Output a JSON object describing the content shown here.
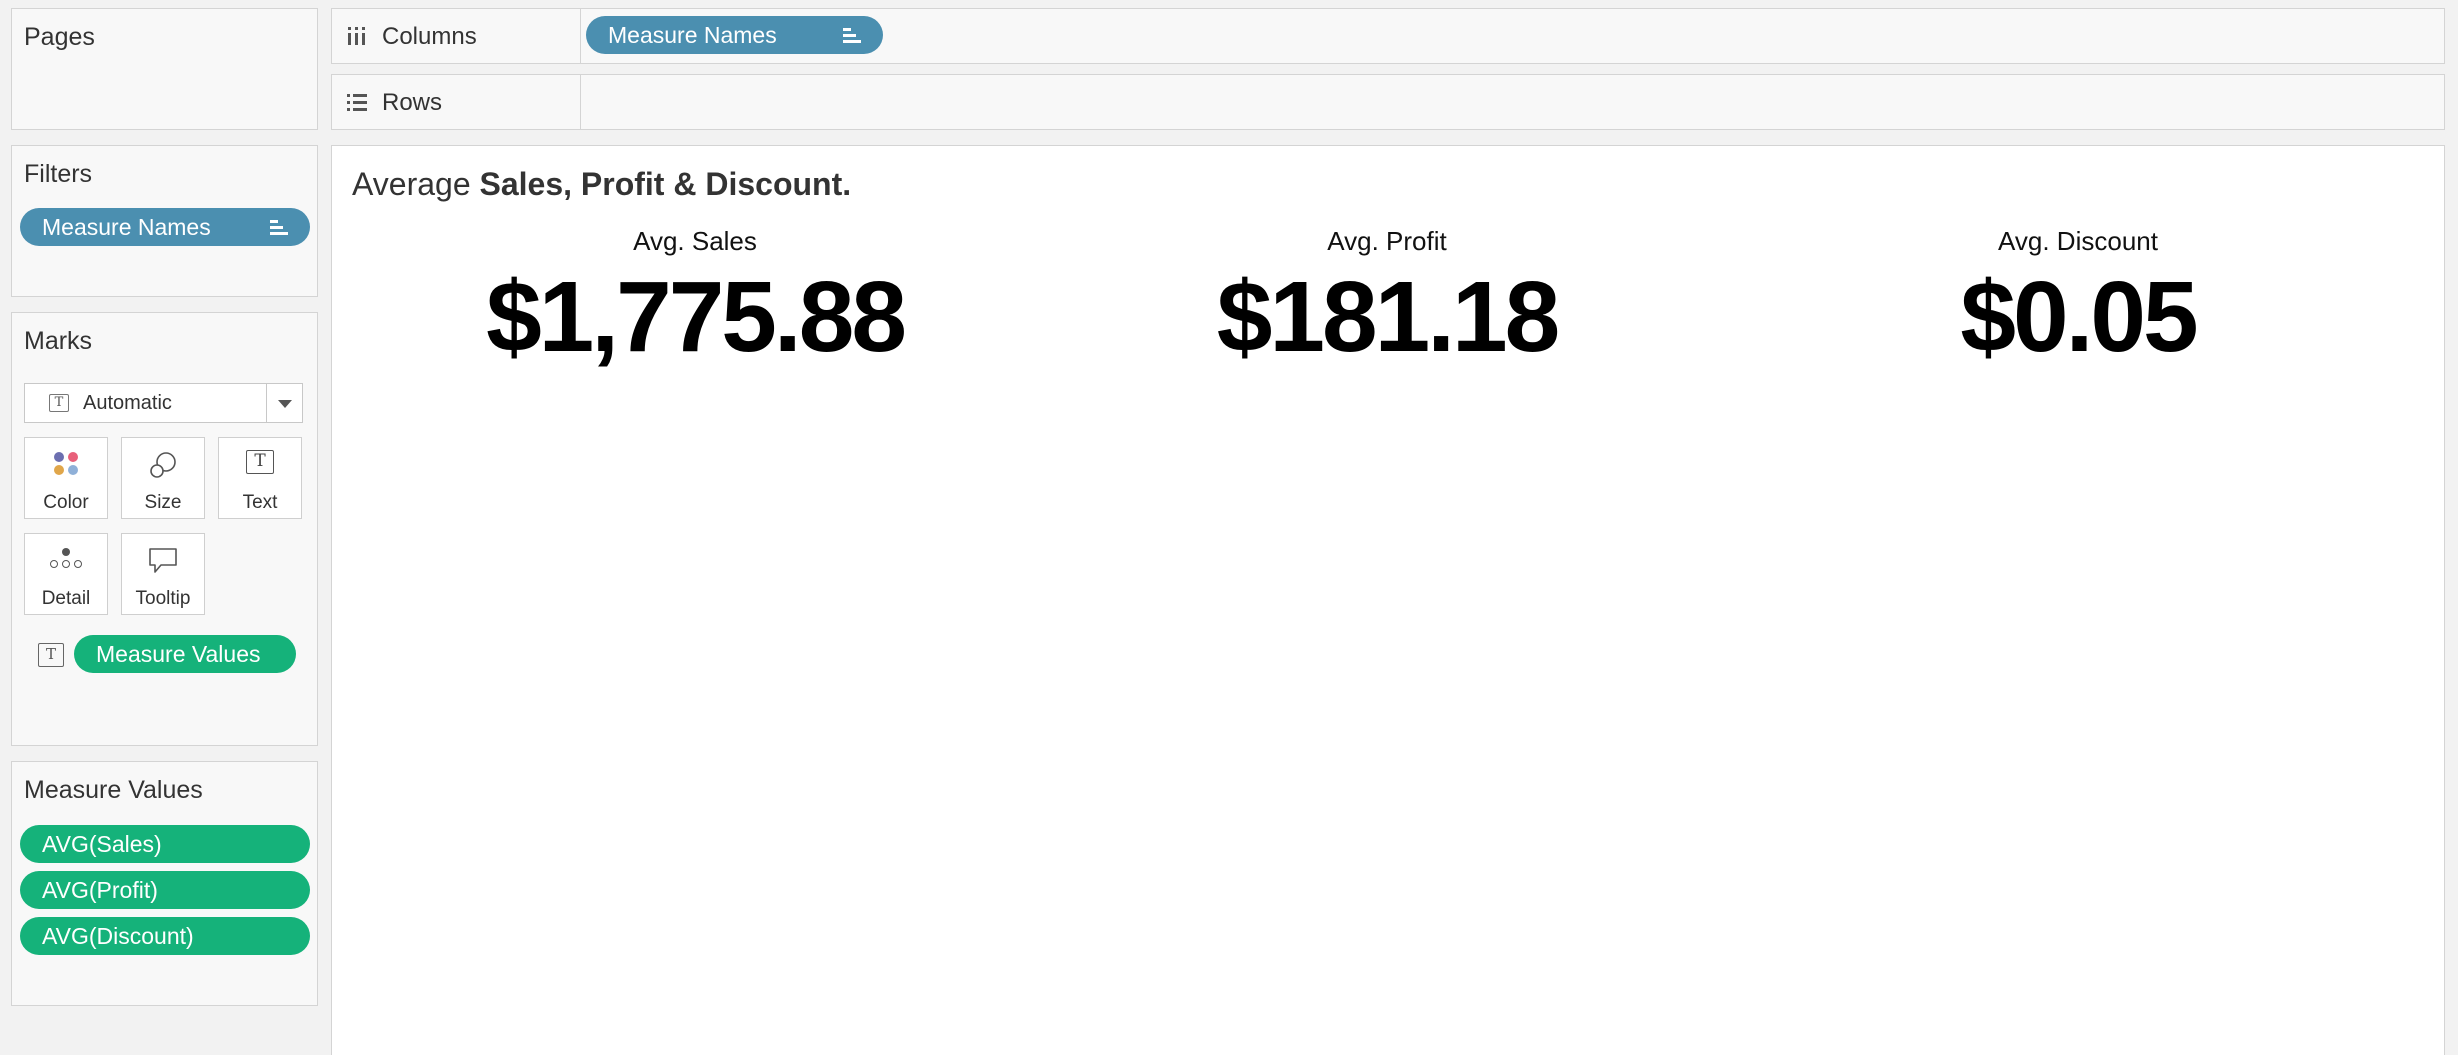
{
  "cards": {
    "pages": {
      "title": "Pages"
    },
    "filters": {
      "title": "Filters",
      "pills": [
        {
          "label": "Measure Names",
          "type": "dimension"
        }
      ]
    },
    "marks": {
      "title": "Marks",
      "mark_type": "Automatic",
      "buttons": [
        "Color",
        "Size",
        "Text",
        "Detail",
        "Tooltip"
      ],
      "text_field": "Measure Values"
    },
    "measure_values": {
      "title": "Measure Values",
      "pills": [
        "AVG(Sales)",
        "AVG(Profit)",
        "AVG(Discount)"
      ]
    }
  },
  "shelves": {
    "columns": {
      "label": "Columns",
      "pills": [
        "Measure Names"
      ]
    },
    "rows": {
      "label": "Rows",
      "pills": []
    }
  },
  "view": {
    "title_prefix": "Average ",
    "title_bold": "Sales, Profit & Discount.",
    "kpis": [
      {
        "label": "Avg. Sales",
        "value": "$1,775.88"
      },
      {
        "label": "Avg. Profit",
        "value": "$181.18"
      },
      {
        "label": "Avg. Discount",
        "value": "$0.05"
      }
    ]
  },
  "colors": {
    "dimension_pill": "#4b8fb0",
    "measure_pill": "#15b27a",
    "panel_bg": "#f8f8f8",
    "view_bg": "#ffffff"
  }
}
